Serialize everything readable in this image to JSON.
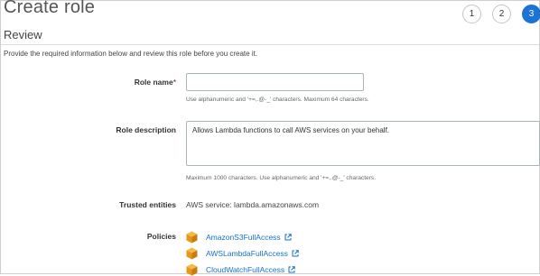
{
  "page": {
    "title": "Create role",
    "steps": [
      "1",
      "2",
      "3"
    ],
    "active_step": "3"
  },
  "review": {
    "section_title": "Review",
    "intro": "Provide the required information below and review this role before you create it."
  },
  "form": {
    "role_name": {
      "label": "Role name",
      "required_marker": "*",
      "value": "",
      "hint": "Use alphanumeric and '+=,.@-_' characters. Maximum 64 characters."
    },
    "role_description": {
      "label": "Role description",
      "value": "Allows Lambda functions to call AWS services on your behalf.",
      "hint": "Maximum 1000 characters. Use alphanumeric and '+=,.@-_' characters."
    },
    "trusted_entities": {
      "label": "Trusted entities",
      "value": "AWS service: lambda.amazonaws.com"
    },
    "policies": {
      "label": "Policies",
      "items": [
        {
          "name": "AmazonS3FullAccess",
          "icon": "policy-cube-icon",
          "link_icon": "external-link-icon"
        },
        {
          "name": "AWSLambdaFullAccess",
          "icon": "policy-cube-icon",
          "link_icon": "external-link-icon"
        },
        {
          "name": "CloudWatchFullAccess",
          "icon": "policy-cube-icon",
          "link_icon": "external-link-icon"
        }
      ]
    }
  },
  "colors": {
    "accent": "#1d73d3",
    "link": "#1a6fc9",
    "policy_icon": "#f0a21b"
  }
}
